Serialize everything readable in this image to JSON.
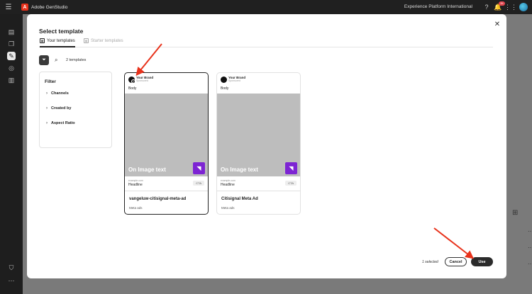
{
  "app": {
    "title": "Adobe GenStudio",
    "org": "Experience Platform International",
    "notifications": "9+"
  },
  "modal": {
    "title": "Select template",
    "tabs": [
      {
        "label": "Your templates"
      },
      {
        "label": "Starter templates"
      }
    ],
    "count": "2 templates",
    "filter": {
      "title": "Filter",
      "items": [
        "Channels",
        "Created by",
        "Aspect Ratio"
      ]
    },
    "templates": [
      {
        "brand": "Your Brand",
        "sponsored": "Sponsored",
        "body": "Body",
        "image_text": "On Image text",
        "url": "example.com",
        "headline": "Headline",
        "cta": "CTA",
        "name": "vangeluw-citisignal-meta-ad",
        "channel": "Meta ads",
        "selected": true
      },
      {
        "brand": "Your Brand",
        "sponsored": "Sponsored",
        "body": "Body",
        "image_text": "On Image text",
        "url": "example.com",
        "headline": "Headline",
        "cta": "CTA",
        "name": "Citisignal Meta Ad",
        "channel": "Meta ads",
        "selected": false
      }
    ],
    "footer": {
      "selected": "1 selected",
      "cancel": "Cancel",
      "use": "Use"
    }
  },
  "colors": {
    "accent_purple": "#7d24d3",
    "annotation_red": "#e8321b",
    "adobe_red": "#e8321b"
  }
}
